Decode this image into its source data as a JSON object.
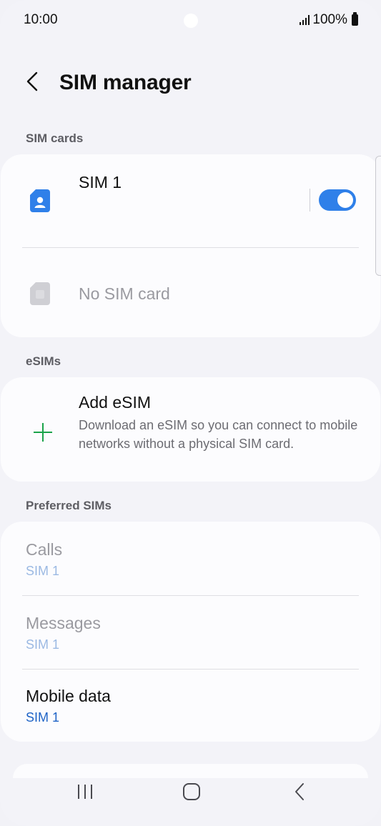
{
  "status": {
    "time": "10:00",
    "battery": "100%"
  },
  "header": {
    "title": "SIM manager"
  },
  "sections": {
    "sim_cards": "SIM cards",
    "esims": "eSIMs",
    "preferred": "Preferred SIMs"
  },
  "sim_cards": [
    {
      "name": "SIM 1",
      "enabled": true
    },
    {
      "name": "No SIM card"
    }
  ],
  "esim": {
    "title": "Add eSIM",
    "description": "Download an eSIM so you can connect to mobile networks without a physical SIM card."
  },
  "preferred": [
    {
      "title": "Calls",
      "value": "SIM 1"
    },
    {
      "title": "Messages",
      "value": "SIM 1"
    },
    {
      "title": "Mobile data",
      "value": "SIM 1"
    }
  ],
  "colors": {
    "accent": "#2f80e9",
    "add_icon": "#1aa34a",
    "link": "#1e63c6"
  },
  "icons": [
    "back-icon",
    "sim-card-icon",
    "plus-icon",
    "recents-icon",
    "home-icon",
    "nav-back-icon"
  ]
}
